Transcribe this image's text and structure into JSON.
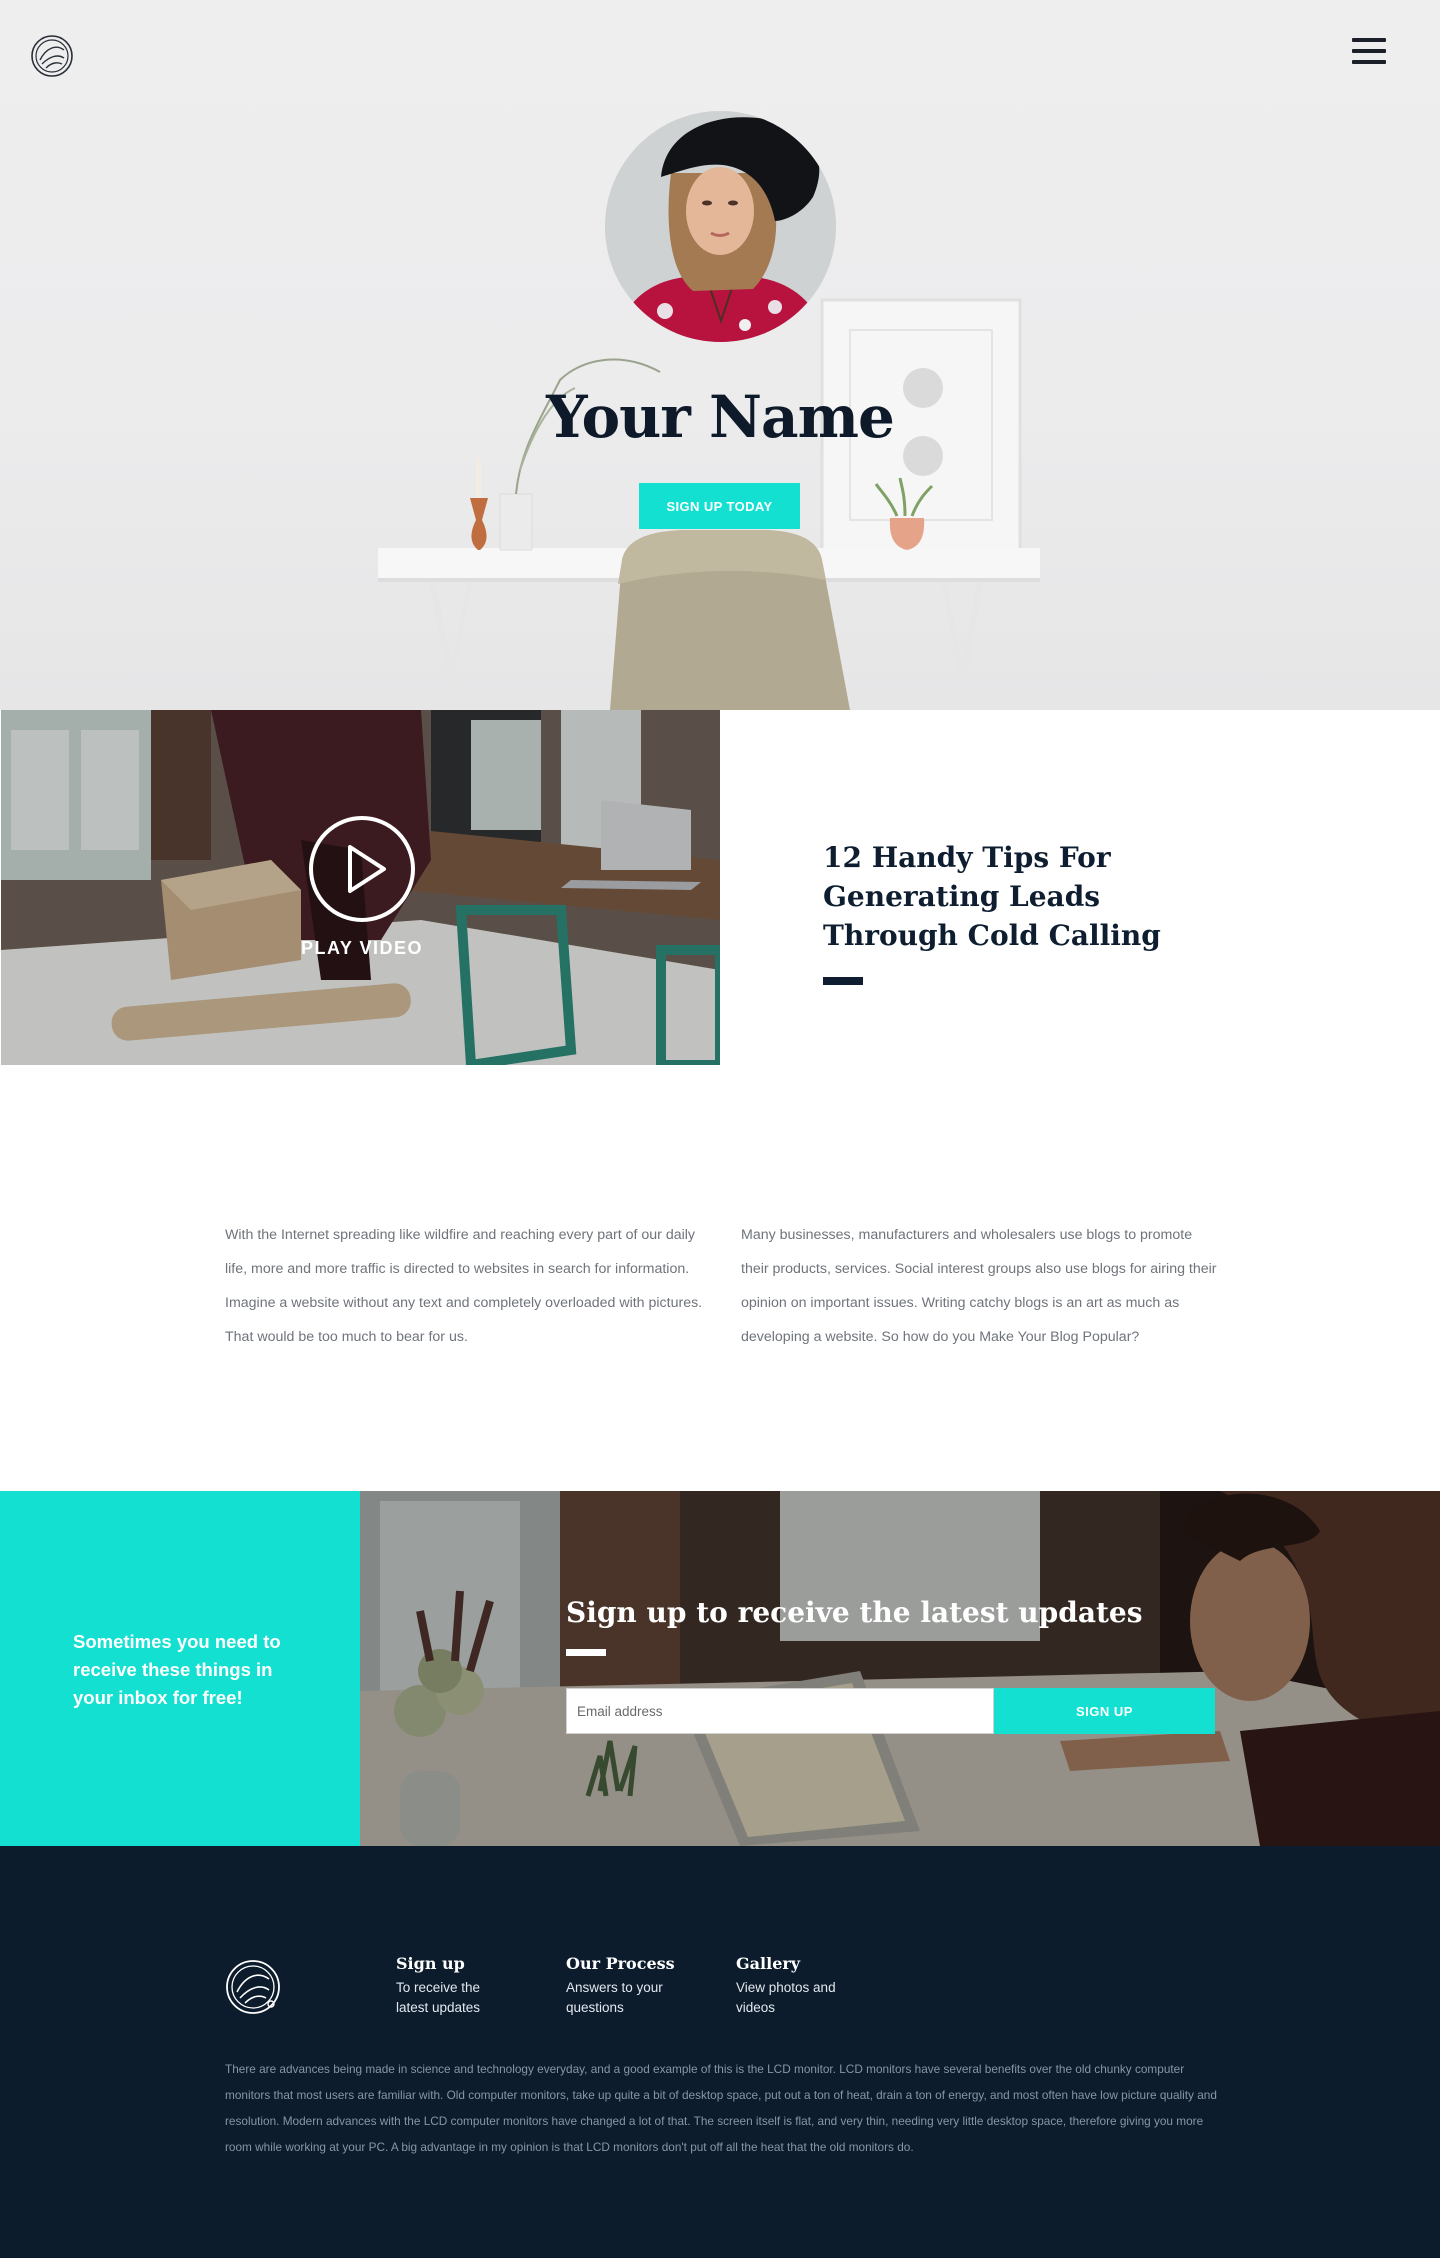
{
  "header": {
    "logo_icon": "circle-leaf-logo-icon",
    "menu_icon": "hamburger-menu-icon"
  },
  "hero": {
    "title": "Your Name",
    "cta_label": "SIGN UP TODAY"
  },
  "feature": {
    "play_label": "PLAY VIDEO",
    "play_icon": "play-icon",
    "title": "12 Handy Tips For Generating Leads Through Cold Calling"
  },
  "body_columns": {
    "left": "With the Internet spreading like wildfire and reaching every part of our daily life, more and more traffic is directed to websites in search for information. Imagine a website without any text and completely overloaded with pictures. That would be too much to bear for us.",
    "right": "Many businesses, manufacturers and wholesalers use blogs to promote their products, services. Social interest groups also use blogs for airing their opinion on important issues. Writing catchy blogs is an art as much as developing a website. So how do you Make Your Blog Popular?"
  },
  "signup": {
    "promo_text": "Sometimes you need to receive these things in your inbox  for free!",
    "title": "Sign up to receive the latest updates",
    "email_placeholder": "Email address",
    "button_label": "SIGN UP"
  },
  "footer": {
    "columns": [
      {
        "title": "Sign up",
        "text": "To receive the latest updates"
      },
      {
        "title": "Our Process",
        "text": "Answers to your questions"
      },
      {
        "title": "Gallery",
        "text": "View photos and videos"
      }
    ],
    "paragraph": "There are advances being made in science and technology everyday, and a good example of this is the LCD monitor. LCD monitors have several benefits over the old chunky computer monitors that most users are familiar with. Old computer monitors, take up quite a bit of desktop space, put out a ton of heat, drain a ton of energy, and most often have low picture quality and resolution. Modern advances with the LCD computer monitors have changed a lot of that. The screen itself is flat, and very thin, needing very little desktop space, therefore giving you more room while working at your PC. A big advantage in my opinion is that LCD monitors don't put off all the heat that the old monitors do."
  },
  "colors": {
    "accent": "#14e0d2",
    "navy": "#0c1c2c",
    "body_text": "#6f747b"
  }
}
